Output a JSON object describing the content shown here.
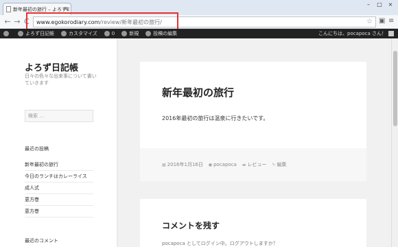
{
  "browser": {
    "tab_title": "新年最初の旅行 – よろずE",
    "tab_close": "×",
    "window_buttons": [
      "–",
      "□",
      "×"
    ],
    "url_host": "www.egokorodiary.com",
    "url_path": "/review/新年最初の旅行/",
    "nav_icons": [
      "back-icon",
      "forward-icon",
      "reload-icon"
    ],
    "toolbar_icons": [
      "star-icon",
      "camera-icon",
      "menu-icon"
    ]
  },
  "adminbar": {
    "items": [
      "よろず日記帳",
      "カスタマイズ",
      "0",
      "新規",
      "投稿の編集"
    ],
    "greeting": "こんにちは、pocapoca さん！"
  },
  "sidebar": {
    "site_title": "よろず日記帳",
    "site_desc": "日々の色々な出来事について書いていきます",
    "search_placeholder": "検索 …",
    "recent_posts_title": "最近の投稿",
    "recent_posts": [
      "新年最初の旅行",
      "今日のランチはカレーライス",
      "成人式",
      "恵方巻",
      "恵方巻"
    ],
    "recent_comments_title": "最近のコメント"
  },
  "post": {
    "title": "新年最初の旅行",
    "body": "2016年最初の旅行は温泉に行きたいです。",
    "date": "2016年1月16日",
    "author": "pocapoca",
    "category": "レビュー",
    "edit": "編集"
  },
  "comments": {
    "title": "コメントを残す",
    "note": "pocapoca としてログイン中。ログアウトしますか？"
  }
}
